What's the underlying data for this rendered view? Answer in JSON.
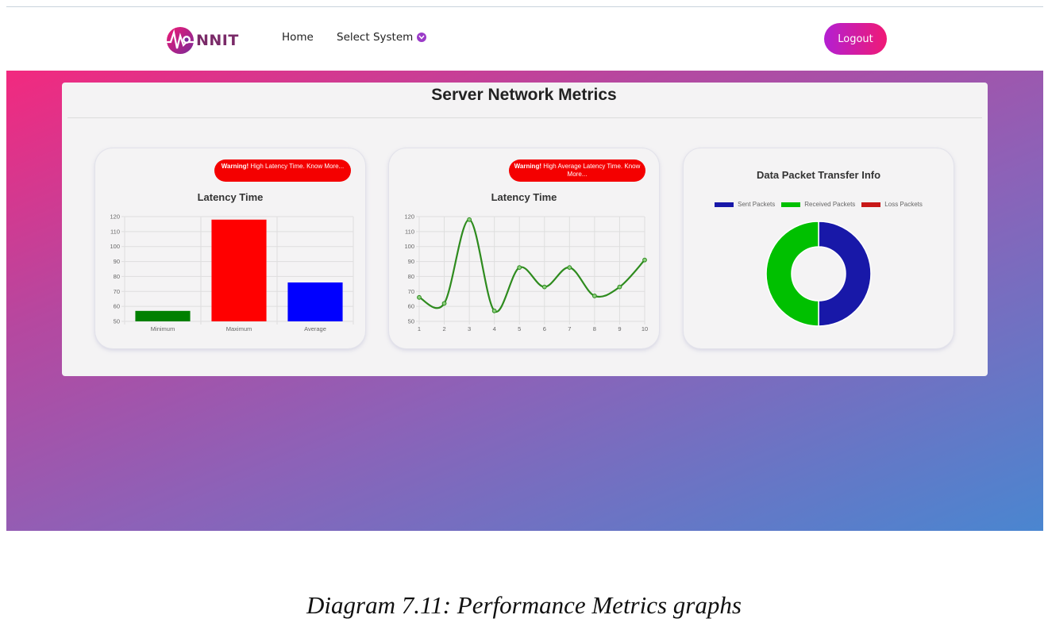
{
  "navbar": {
    "logo_text": "NNIT",
    "home_label": "Home",
    "select_system_label": "Select System",
    "logout_label": "Logout"
  },
  "panel": {
    "title": "Server Network Metrics"
  },
  "cards": [
    {
      "warning_bold": "Warning!",
      "warning_text": " High Latency Time. Know More...",
      "title": "Latency Time"
    },
    {
      "warning_bold": "Warning!",
      "warning_text": " High Average Latency Time. Know More...",
      "title": "Latency Time"
    },
    {
      "title": "Data Packet Transfer Info"
    }
  ],
  "colors": {
    "brand_gradient_start": "#b31fd2",
    "brand_gradient_end": "#f01a75",
    "warning": "#f40000",
    "bar_min": "#008000",
    "bar_max": "#ff0000",
    "bar_avg": "#0000ff",
    "line": "#2e8b1e",
    "sent": "#1818a8",
    "received": "#00c000",
    "loss": "#c81818"
  },
  "chart_data": [
    {
      "type": "bar",
      "title": "Latency Time",
      "categories": [
        "Minimum",
        "Maximum",
        "Average"
      ],
      "values": [
        57,
        118,
        76
      ],
      "ylim": [
        50,
        120
      ],
      "yticks": [
        50,
        60,
        70,
        80,
        90,
        100,
        110,
        120
      ],
      "grid": true
    },
    {
      "type": "line",
      "title": "Latency Time",
      "x": [
        1,
        2,
        3,
        4,
        5,
        6,
        7,
        8,
        9,
        10
      ],
      "values": [
        66,
        62,
        118,
        57,
        86,
        73,
        86,
        67,
        73,
        91
      ],
      "ylim": [
        50,
        120
      ],
      "yticks": [
        50,
        60,
        70,
        80,
        90,
        100,
        110,
        120
      ],
      "grid": true
    },
    {
      "type": "pie",
      "subtype": "doughnut",
      "title": "Data Packet Transfer Info",
      "labels": [
        "Sent Packets",
        "Received Packets",
        "Loss Packets"
      ],
      "values": [
        50,
        50,
        0
      ],
      "legend": "top"
    }
  ],
  "caption": "Diagram 7.11: Performance Metrics graphs"
}
